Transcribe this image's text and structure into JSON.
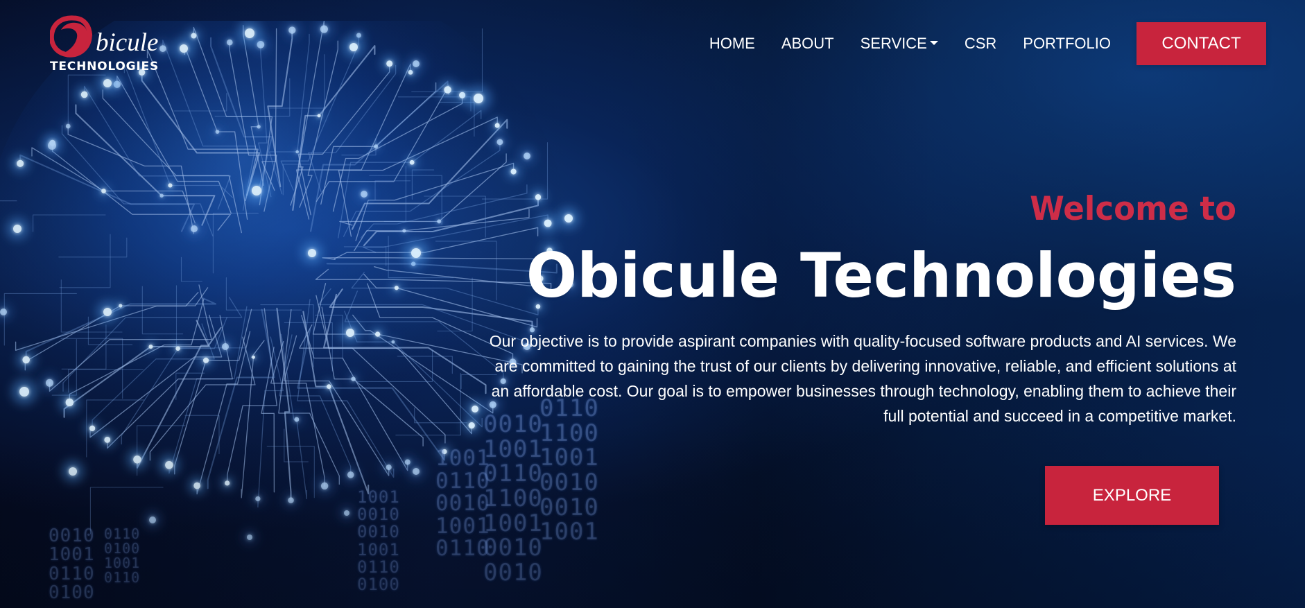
{
  "logo": {
    "wordmark": "bicule",
    "tagline": "TECHNOLOGIES",
    "icon": "red-circle-o-logo-icon",
    "brand_color": "#c8243d"
  },
  "nav": {
    "items": [
      {
        "label": "HOME"
      },
      {
        "label": "ABOUT"
      },
      {
        "label": "SERVICE",
        "icon": "chevron-down-icon"
      },
      {
        "label": "CSR"
      },
      {
        "label": "PORTFOLIO"
      }
    ],
    "contact_label": "CONTACT"
  },
  "hero": {
    "welcome": "Welcome to",
    "title": "Obicule Technologies",
    "description": "Our objective is to provide aspirant companies with quality-focused software products and AI services. We are committed to gaining the trust of our clients by delivering innovative, reliable, and efficient solutions at an affordable cost. Our goal is to empower businesses through technology, enabling them to achieve their full potential and succeed in a competitive market.",
    "explore_label": "EXPLORE",
    "accent_color": "#ce2d48",
    "background_colors": [
      "#050a1f",
      "#0b327b",
      "#062250"
    ],
    "background_art": "blue-circuit-brain-icon",
    "binary_digits": [
      "0010",
      "1001",
      "0110",
      "0100",
      "1001",
      "0110",
      "0010",
      "1001",
      "0110",
      "1100",
      "1001",
      "0010"
    ]
  }
}
